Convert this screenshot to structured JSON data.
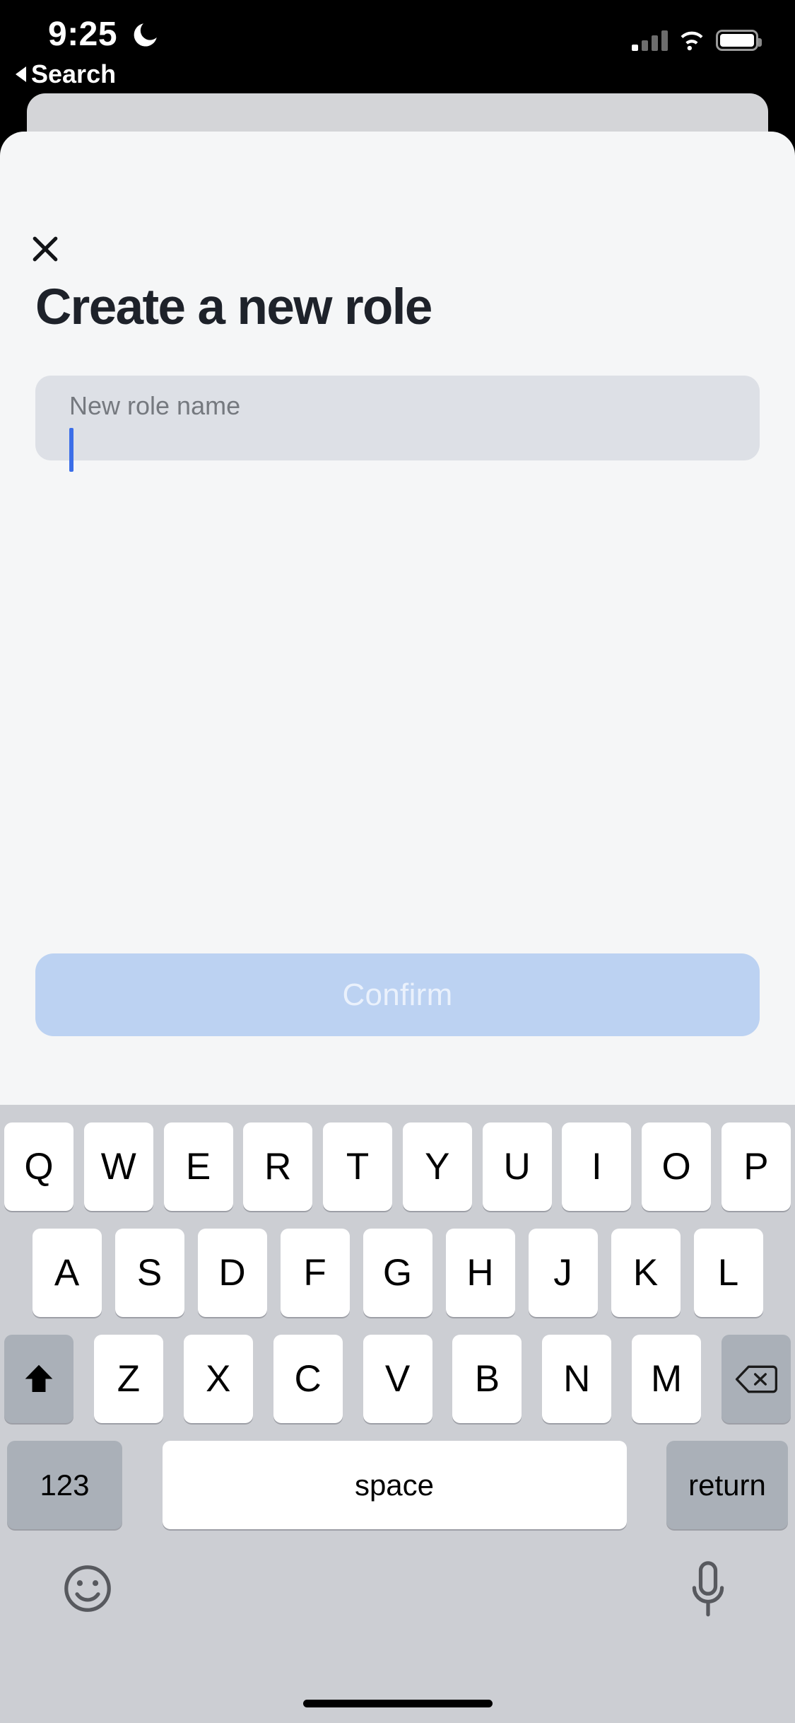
{
  "status_bar": {
    "time": "9:25",
    "dnd_icon": "crescent-moon-icon",
    "back_label": "Search",
    "signal_icon": "cellular-signal-icon",
    "signal_bars_filled": 1,
    "signal_bars_total": 4,
    "wifi_icon": "wifi-icon",
    "battery_icon": "battery-full-icon"
  },
  "sheet": {
    "close_icon": "close-x-icon",
    "title": "Create a new role",
    "input": {
      "label": "New role name",
      "value": "",
      "placeholder": "New role name",
      "caret_color": "#3b6ee8",
      "background": "#dde0e6"
    },
    "confirm_button": {
      "label": "Confirm",
      "enabled": false,
      "background": "#bcd2f2",
      "text_color": "#eaf1fc"
    },
    "background": "#f5f6f7"
  },
  "keyboard": {
    "background": "#ccced3",
    "row1": [
      "Q",
      "W",
      "E",
      "R",
      "T",
      "Y",
      "U",
      "I",
      "O",
      "P"
    ],
    "row2": [
      "A",
      "S",
      "D",
      "F",
      "G",
      "H",
      "J",
      "K",
      "L"
    ],
    "row3_letters": [
      "Z",
      "X",
      "C",
      "V",
      "B",
      "N",
      "M"
    ],
    "shift_icon": "shift-up-arrow-icon",
    "backspace_icon": "delete-backward-icon",
    "numbers_key": "123",
    "space_key": "space",
    "return_key": "return",
    "emoji_icon": "emoji-smiley-icon",
    "dictation_icon": "microphone-icon"
  },
  "home_indicator": "home-indicator-bar"
}
